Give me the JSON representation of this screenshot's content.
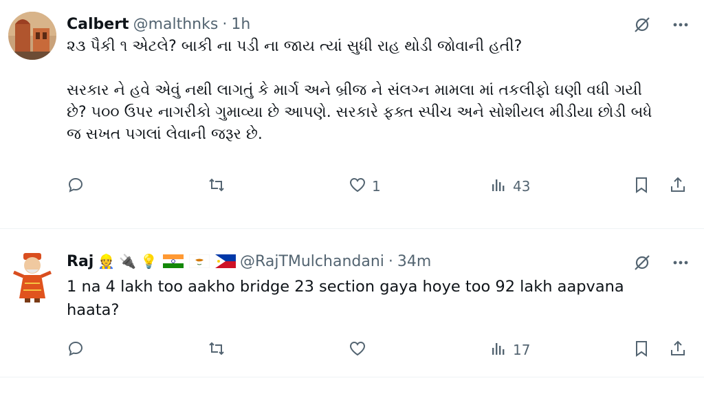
{
  "tweets": [
    {
      "display_name": "Calbert",
      "handle": "@malthnks",
      "separator": "·",
      "time": "1h",
      "text": "૨૩ પૈકી ૧ એટલે? બાકી ના પડી ના જાય ત્યાં સુધી રાહ થોડી જોવાની હતી?\n\nસરકાર ને હવે એવું નથી લાગતું કે માર્ગ અને બ્રીજ ને સંલગ્ન મામલા માં તકલીફો ઘણી વધી ગયી છે? ૫૦૦ ઉપર નાગરીકો ગુમાવ્યા છે આપણે. સરકારે ફક્ત સ્પીચ અને સોશીયલ મીડીયા છોડી બધે જ સખત પગલાં લેવાની જરૂર છે.",
      "reply_count": "",
      "retweet_count": "",
      "like_count": "1",
      "view_count": "43"
    },
    {
      "display_name": "Raj",
      "name_emojis": [
        "👷",
        "🔌",
        "💡"
      ],
      "flags": [
        "India",
        "Cyprus",
        "Philippines"
      ],
      "handle": "@RajTMulchandani",
      "separator": "·",
      "time": "34m",
      "text": "1 na 4 lakh too aakho bridge 23 section gaya hoye too 92 lakh aapvana haata?",
      "reply_count": "",
      "retweet_count": "",
      "like_count": "",
      "view_count": "17"
    }
  ],
  "icons": {
    "top_actions": [
      "grok-icon",
      "more-icon"
    ],
    "row_actions": [
      "reply-icon",
      "retweet-icon",
      "like-icon",
      "views-icon",
      "bookmark-icon",
      "share-icon"
    ]
  },
  "colors": {
    "text": "#0f1419",
    "secondary": "#536471",
    "divider": "#eff3f4"
  }
}
